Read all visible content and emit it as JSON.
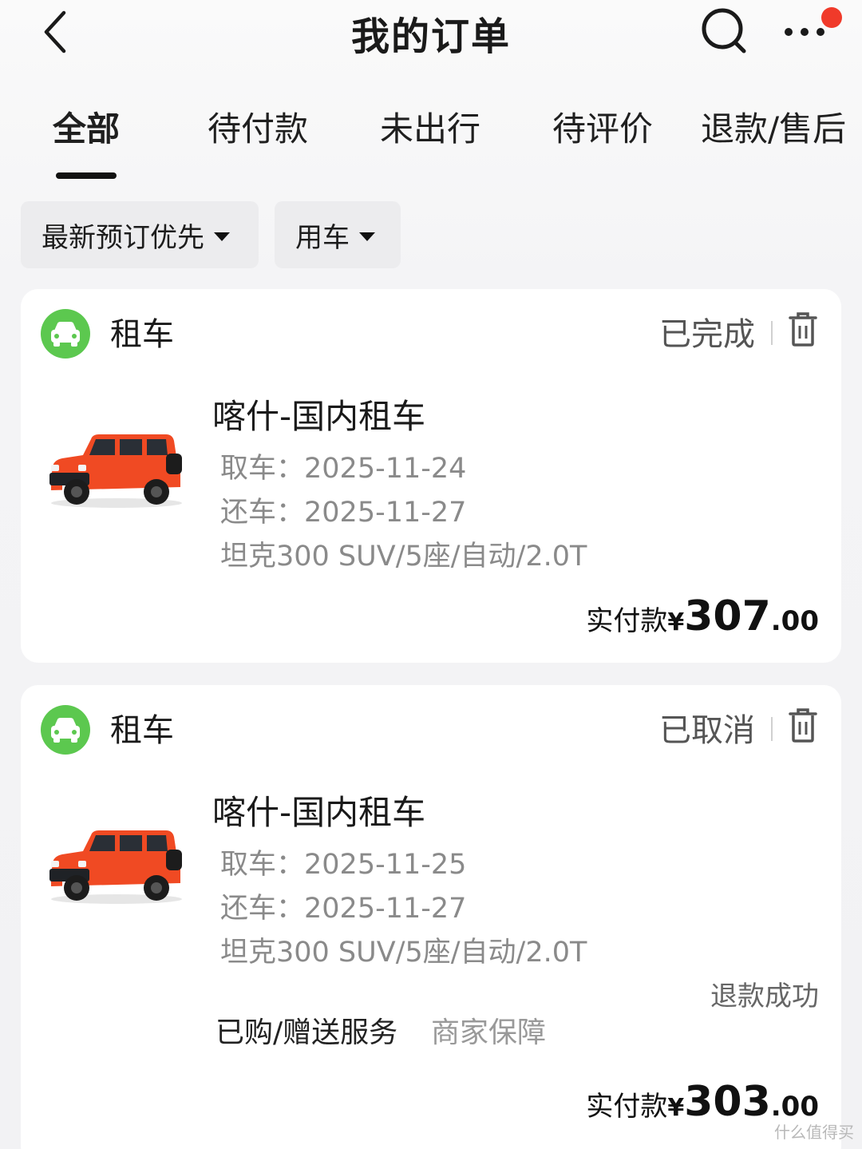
{
  "header": {
    "title": "我的订单"
  },
  "tabs": [
    {
      "label": "全部"
    },
    {
      "label": "待付款"
    },
    {
      "label": "未出行"
    },
    {
      "label": "待评价"
    },
    {
      "label": "退款/售后"
    }
  ],
  "filters": {
    "sort_label": "最新预订优先",
    "type_label": "用车"
  },
  "colors": {
    "category_icon": "#5cc84f",
    "car_body": "#f04a23",
    "notification_dot": "#f03a2a"
  },
  "orders": [
    {
      "category": "租车",
      "status": "已完成",
      "title": "喀什-国内租车",
      "pickup_label": "取车：",
      "pickup_date": "2025-11-24",
      "return_label": "还车：",
      "return_date": "2025-11-27",
      "car_spec": "坦克300 SUV/5座/自动/2.0T",
      "price_label": "实付款",
      "currency": "¥",
      "price_int": "307",
      "price_dec": ".00"
    },
    {
      "category": "租车",
      "status": "已取消",
      "title": "喀什-国内租车",
      "pickup_label": "取车：",
      "pickup_date": "2025-11-25",
      "return_label": "还车：",
      "return_date": "2025-11-27",
      "car_spec": "坦克300 SUV/5座/自动/2.0T",
      "refund_status": "退款成功",
      "services_label": "已购/赠送服务",
      "guarantee_label": "商家保障",
      "price_label": "实付款",
      "currency": "¥",
      "price_int": "303",
      "price_dec": ".00"
    }
  ],
  "watermark": "什么值得买"
}
